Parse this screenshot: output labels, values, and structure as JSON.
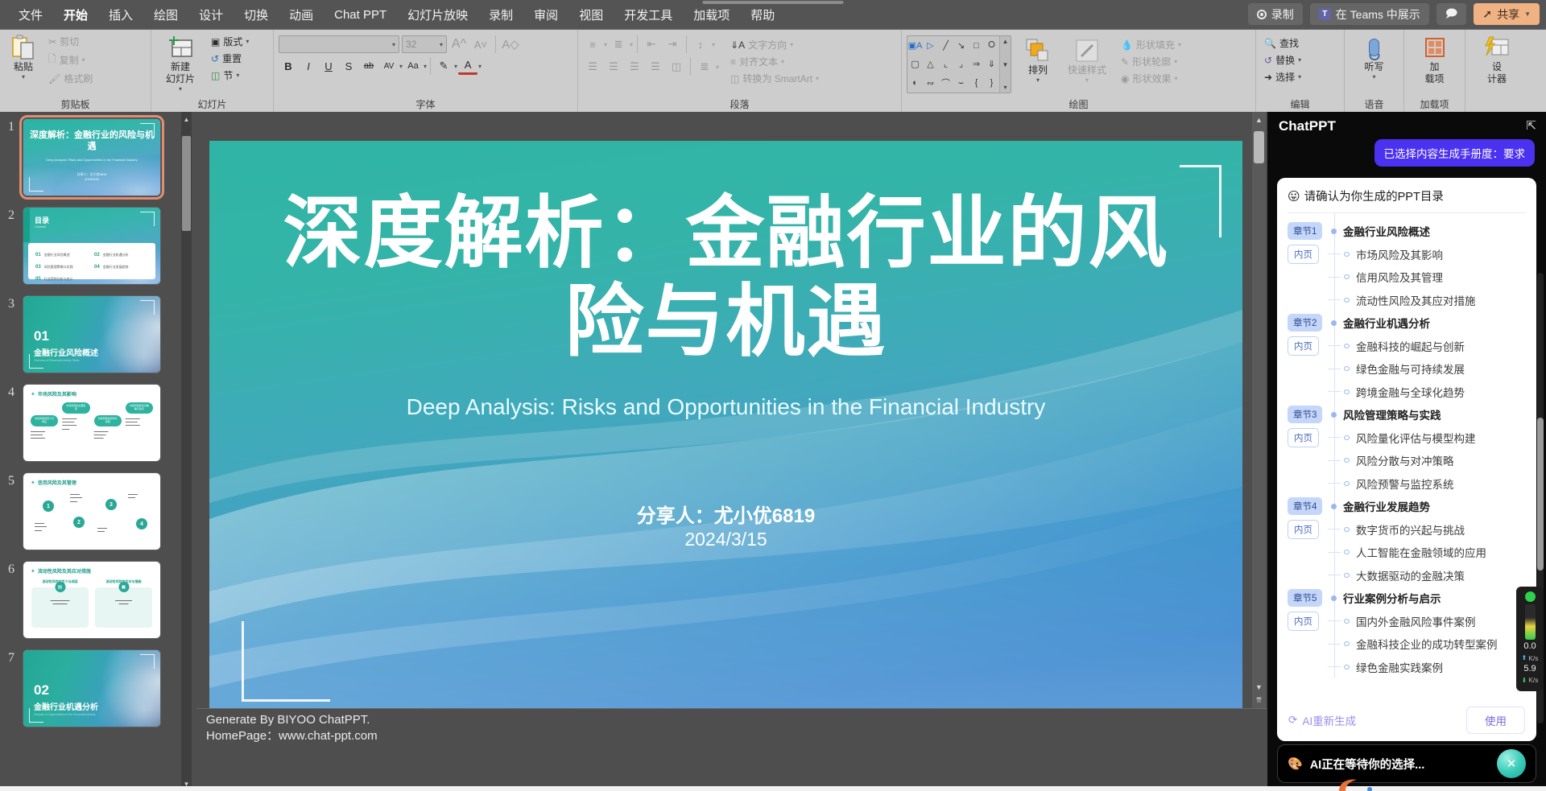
{
  "window": {
    "menu_tabs": [
      {
        "label": "文件",
        "active": false
      },
      {
        "label": "开始",
        "active": true
      },
      {
        "label": "插入",
        "active": false
      },
      {
        "label": "绘图",
        "active": false
      },
      {
        "label": "设计",
        "active": false
      },
      {
        "label": "切换",
        "active": false
      },
      {
        "label": "动画",
        "active": false
      },
      {
        "label": "Chat PPT",
        "active": false
      },
      {
        "label": "幻灯片放映",
        "active": false
      },
      {
        "label": "录制",
        "active": false
      },
      {
        "label": "审阅",
        "active": false
      },
      {
        "label": "视图",
        "active": false
      },
      {
        "label": "开发工具",
        "active": false
      },
      {
        "label": "加载项",
        "active": false
      },
      {
        "label": "帮助",
        "active": false
      }
    ],
    "top_right": {
      "record_label": "录制",
      "teams_label": "在 Teams 中展示",
      "teams_badge": "T",
      "comment_icon": "comment-icon",
      "share_label": "共享",
      "share_color": "#f0b183"
    }
  },
  "ribbon": {
    "groups": [
      {
        "name": "clipboard",
        "label": "剪贴板",
        "paste_label": "粘贴",
        "items": [
          {
            "label": "剪切",
            "icon": "scissors-icon",
            "disabled": true
          },
          {
            "label": "复制",
            "icon": "copy-icon",
            "disabled": true
          },
          {
            "label": "格式刷",
            "icon": "format-painter-icon",
            "disabled": true
          }
        ]
      },
      {
        "name": "slides",
        "label": "幻灯片",
        "new_slide_label": "新建\n幻灯片",
        "items": [
          {
            "label": "版式",
            "icon": "layout-icon"
          },
          {
            "label": "重置",
            "icon": "reset-icon"
          },
          {
            "label": "节",
            "icon": "section-icon"
          }
        ]
      },
      {
        "name": "font",
        "label": "字体",
        "font_name_value": "",
        "font_name_placeholder": "",
        "font_size_value": "32",
        "grow_font": "A",
        "shrink_font": "A",
        "clear_format": "A",
        "row2": [
          "B",
          "I",
          "U",
          "S",
          "ab",
          "AV",
          "Aa",
          "highlight",
          "fontcolor"
        ]
      },
      {
        "name": "paragraph",
        "label": "段落",
        "items": [
          {
            "label": "文字方向",
            "icon": "text-direction-icon"
          },
          {
            "label": "对齐文本",
            "icon": "align-text-icon"
          },
          {
            "label": "转换为 SmartArt",
            "icon": "smartart-icon"
          }
        ]
      },
      {
        "name": "drawing",
        "label": "绘图",
        "arrange_label": "排列",
        "quickstyle_label": "快速样式",
        "items": [
          {
            "label": "形状填充",
            "icon": "shape-fill-icon",
            "disabled": true
          },
          {
            "label": "形状轮廓",
            "icon": "shape-outline-icon",
            "disabled": true
          },
          {
            "label": "形状效果",
            "icon": "shape-effects-icon",
            "disabled": true
          }
        ]
      },
      {
        "name": "editing",
        "label": "编辑",
        "items": [
          {
            "label": "查找",
            "icon": "search-icon"
          },
          {
            "label": "替换",
            "icon": "replace-icon"
          },
          {
            "label": "选择",
            "icon": "select-icon"
          }
        ]
      },
      {
        "name": "voice",
        "label": "语音",
        "dictate_label": "听写"
      },
      {
        "name": "addins",
        "label": "加载项",
        "addin_label": "加\n载项"
      },
      {
        "name": "designer",
        "label": "",
        "designer_label": "设\n计器"
      }
    ]
  },
  "thumbnails": [
    {
      "number": "1",
      "selected": true,
      "kind": "title",
      "title": "深度解析：金融行业的风险与机遇",
      "subtitle": "Deep Analysis: Risks and Opportunities in the Financial Industry",
      "presenter": "分享人：尤小优6819",
      "date": "2024/3/15"
    },
    {
      "number": "2",
      "selected": false,
      "kind": "toc",
      "heading": "目录",
      "heading_en": "Content",
      "items": [
        {
          "no": "01",
          "text": "金融行业风险概述"
        },
        {
          "no": "02",
          "text": "金融行业机遇分析"
        },
        {
          "no": "03",
          "text": "风险管理策略与实践"
        },
        {
          "no": "04",
          "text": "金融行业发展趋势"
        },
        {
          "no": "05",
          "text": "行业案例分析与启示"
        }
      ]
    },
    {
      "number": "3",
      "selected": false,
      "kind": "section",
      "section_no": "01",
      "title": "金融行业风险概述",
      "subtitle_en": "Overview of Financial Industry Risks"
    },
    {
      "number": "4",
      "selected": false,
      "kind": "content-pills",
      "heading": "市场风险及其影响",
      "pills": [
        "市场风险的定义与特征",
        "市场风险的主要来源",
        "市场风险的影响与管理",
        "市场风险的应对策略与建议"
      ]
    },
    {
      "number": "5",
      "selected": false,
      "kind": "content-steps",
      "heading": "信用风险及其管理",
      "steps": [
        "1",
        "2",
        "3",
        "4"
      ]
    },
    {
      "number": "6",
      "selected": false,
      "kind": "content-cards",
      "heading": "流动性风险及其应对措施",
      "cards": [
        "流动性风险的定义与成因",
        "流动性风险的应对与措施"
      ]
    },
    {
      "number": "7",
      "selected": false,
      "kind": "section",
      "section_no": "02",
      "title": "金融行业机遇分析",
      "subtitle_en": "Analysis of Opportunities in the Financial Industry"
    }
  ],
  "slide": {
    "title": "深度解析：金融行业的风险与机遇",
    "subtitle": "Deep Analysis: Risks and Opportunities in the Financial Industry",
    "presenter": "分享人：尤小优6819",
    "date": "2024/3/15",
    "accent_color": "#2fb4a5",
    "gradient_end": "#3f8ad0"
  },
  "notes": {
    "line1": "Generate By BIYOO ChatPPT.",
    "line2": "HomePage：www.chat-ppt.com"
  },
  "chatppt": {
    "title": "ChatPPT",
    "collapse_icon": "collapse-icon",
    "user_bubble": "已选择内容生成手册度：要求",
    "card_emoji": "😛",
    "card_heading": "请确认为你生成的PPT目录",
    "chapter_tag": "章节",
    "inner_tag": "内页",
    "outline": [
      {
        "tag": "章节1",
        "title": "金融行业风险概述",
        "subs": [
          "市场风险及其影响",
          "信用风险及其管理",
          "流动性风险及其应对措施"
        ]
      },
      {
        "tag": "章节2",
        "title": "金融行业机遇分析",
        "subs": [
          "金融科技的崛起与创新",
          "绿色金融与可持续发展",
          "跨境金融与全球化趋势"
        ]
      },
      {
        "tag": "章节3",
        "title": "风险管理策略与实践",
        "subs": [
          "风险量化评估与模型构建",
          "风险分散与对冲策略",
          "风险预警与监控系统"
        ]
      },
      {
        "tag": "章节4",
        "title": "金融行业发展趋势",
        "subs": [
          "数字货币的兴起与挑战",
          "人工智能在金融领域的应用",
          "大数据驱动的金融决策"
        ]
      },
      {
        "tag": "章节5",
        "title": "行业案例分析与启示",
        "subs": [
          "国内外金融风险事件案例",
          "金融科技企业的成功转型案例",
          "绿色金融实践案例"
        ]
      }
    ],
    "regenerate_label": "AI重新生成",
    "use_label": "使用",
    "status_text": "AI正在等待你的选择...",
    "status_icon": "palette-icon",
    "close_icon": "close-icon"
  },
  "net_widget": {
    "upload_value": "0.0",
    "upload_unit": "K/s",
    "download_value": "5.9",
    "download_unit": "K/s"
  }
}
